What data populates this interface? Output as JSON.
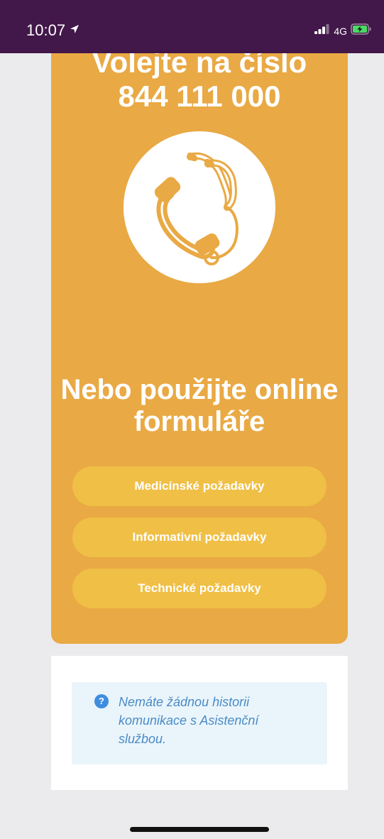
{
  "status_bar": {
    "time": "10:07",
    "network": "4G",
    "location_icon": "location-arrow-icon",
    "signal_icon": "signal-bars-icon",
    "battery_icon": "battery-charging-icon"
  },
  "hotline": {
    "line1": "Volejte na číslo",
    "number": "844 111 000",
    "icon": "stethoscope-phone-icon"
  },
  "forms": {
    "heading": "Nebo použijte online formuláře",
    "buttons": [
      {
        "label": "Medicínské požadavky"
      },
      {
        "label": "Informativní požadavky"
      },
      {
        "label": "Technické požadavky"
      }
    ]
  },
  "history": {
    "info_icon": "question-circle-icon",
    "info_icon_glyph": "?",
    "message": "Nemáte žádnou historii komunikace s Asistenční službou."
  },
  "colors": {
    "status_bar": "#421749",
    "card": "#e9a944",
    "button": "#f0bf45",
    "info_text": "#4a8bc6",
    "info_bg": "#eaf5fb"
  }
}
